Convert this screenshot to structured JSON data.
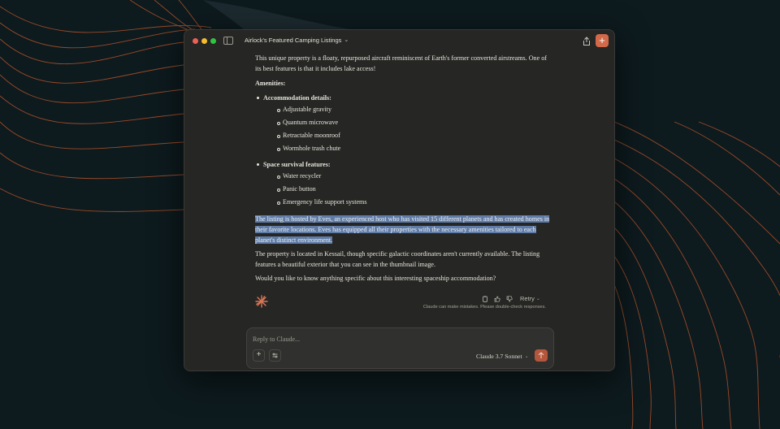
{
  "window": {
    "title": "Airlock's Featured Camping Listings"
  },
  "message": {
    "intro": "This unique property is a floaty, repurposed aircraft reminiscent of Earth's former converted airstreams. One of its best features is that it includes lake access!",
    "amenities_heading": "Amenities:",
    "categories": [
      {
        "label": "Accommodation details:",
        "items": [
          "Adjustable gravity",
          "Quantum microwave",
          "Retractable moonroof",
          "Wormhole trash chute"
        ]
      },
      {
        "label": "Space survival features:",
        "items": [
          "Water recycler",
          "Panic button",
          "Emergency life support systems"
        ]
      }
    ],
    "host_paragraph": "The listing is hosted by Eves, an experienced host who has visited 15 different planets and has created homes in their favorite locations. Eves has equipped all their properties with the necessary amenities tailored to each planet's distinct environment.",
    "location_paragraph": "The property is located in Kessail, though specific galactic coordinates aren't currently available. The listing features a beautiful exterior that you can see in the thumbnail image.",
    "question": "Would you like to know anything specific about this interesting spaceship accommodation?"
  },
  "actions": {
    "retry_label": "Retry",
    "disclaimer": "Claude can make mistakes. Please double-check responses."
  },
  "composer": {
    "placeholder": "Reply to Claude...",
    "model": "Claude 3.7 Sonnet"
  },
  "colors": {
    "accent": "#d26a4a",
    "selection": "#5f7ca8",
    "background": "#0d1a1e"
  },
  "icons": [
    "sidebar-icon",
    "chevron-down-icon",
    "share-icon",
    "plus-icon",
    "claude-logo-icon",
    "copy-icon",
    "thumbs-up-icon",
    "thumbs-down-icon",
    "sliders-icon",
    "arrow-up-icon"
  ]
}
